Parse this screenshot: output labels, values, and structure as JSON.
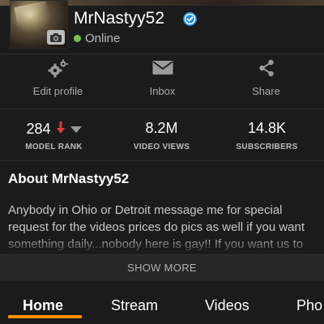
{
  "profile": {
    "username": "MrNastyy52",
    "status": "Online",
    "colors": {
      "online": "#7ac143",
      "verified": "#1d8fe1",
      "accent": "#ff9000",
      "rank_down": "#e53935"
    }
  },
  "actions": [
    {
      "label": "Edit profile",
      "icon": "gears-icon"
    },
    {
      "label": "Inbox",
      "icon": "envelope-icon"
    },
    {
      "label": "Share",
      "icon": "share-icon"
    }
  ],
  "stats": {
    "rank": {
      "value": "284",
      "label": "MODEL RANK",
      "trend": "down"
    },
    "views": {
      "value": "8.2M",
      "label": "VIDEO VIEWS"
    },
    "subscribers": {
      "value": "14.8K",
      "label": "SUBSCRIBERS"
    }
  },
  "about": {
    "title": "About MrNastyy52",
    "text": "Anybody in Ohio or Detroit message me for special request for the videos prices do pics as well if you want something daily...nobody here is gay!! If you want us to",
    "show_more": "SHOW MORE"
  },
  "tabs": {
    "items": [
      "Home",
      "Stream",
      "Videos",
      "Pho"
    ],
    "active": "Home"
  }
}
